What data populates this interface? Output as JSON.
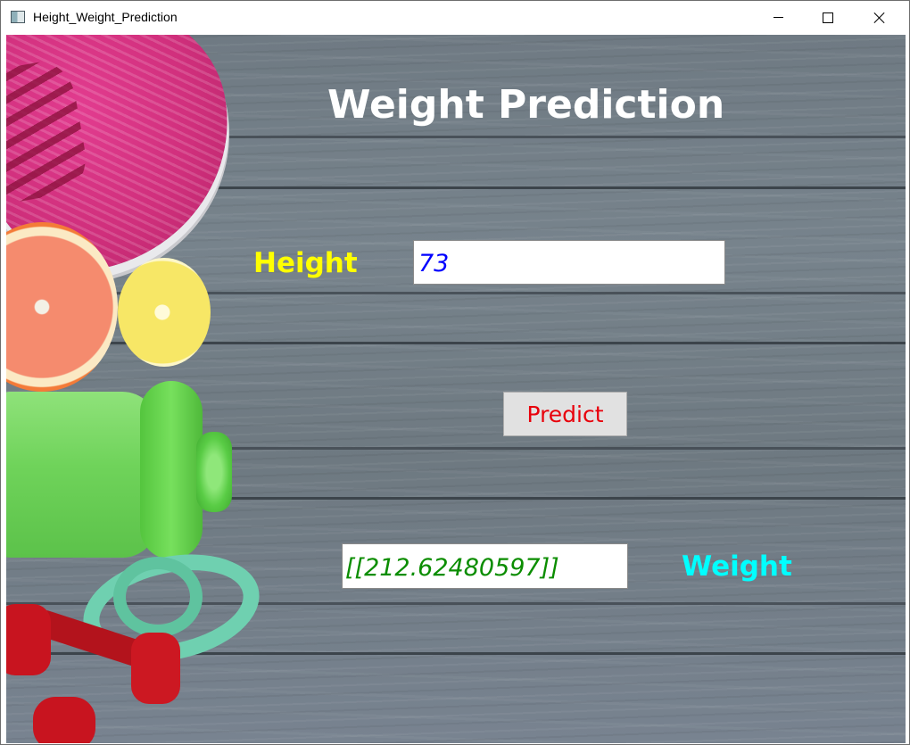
{
  "window": {
    "title": "Height_Weight_Prediction"
  },
  "app": {
    "heading": "Weight Prediction",
    "height_label": "Height",
    "height_value": "73",
    "predict_label": "Predict",
    "weight_output": "[[212.62480597]]",
    "weight_label": "Weight"
  },
  "colors": {
    "heading": "#ffffff",
    "height_label": "#ffff00",
    "height_text": "#0000ff",
    "predict_text": "#e8000b",
    "weight_output_text": "#0b8d00",
    "weight_label": "#00ffff"
  }
}
